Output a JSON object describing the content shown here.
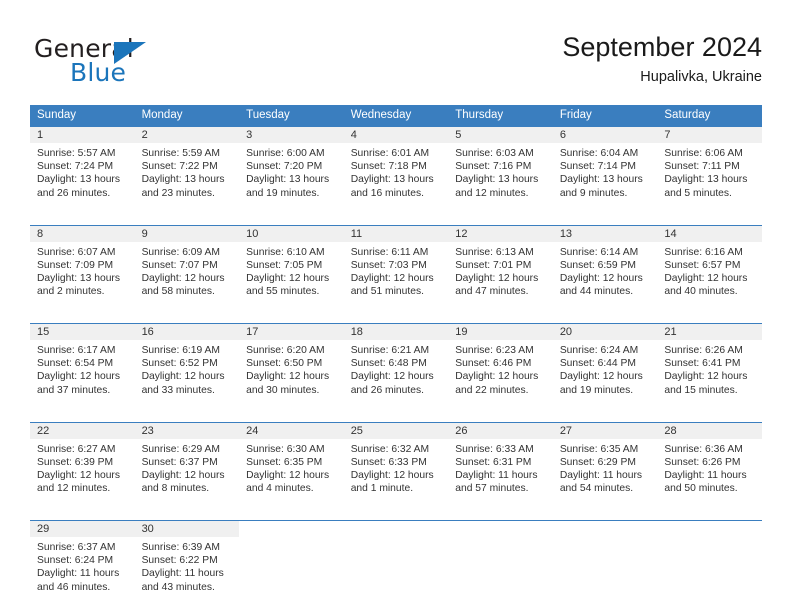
{
  "logo": {
    "word_one": "General",
    "word_two": "Blue",
    "triangle_icon": "blue-triangle-icon"
  },
  "header": {
    "title": "September 2024",
    "location": "Hupalivka, Ukraine"
  },
  "calendar": {
    "accent_color": "#3a7ebf",
    "daynum_band_color": "#f0f0f0",
    "weekday_headers": [
      "Sunday",
      "Monday",
      "Tuesday",
      "Wednesday",
      "Thursday",
      "Friday",
      "Saturday"
    ],
    "weeks": [
      [
        {
          "day": "1",
          "sunrise": "Sunrise: 5:57 AM",
          "sunset": "Sunset: 7:24 PM",
          "daylight_line1": "Daylight: 13 hours",
          "daylight_line2": "and 26 minutes."
        },
        {
          "day": "2",
          "sunrise": "Sunrise: 5:59 AM",
          "sunset": "Sunset: 7:22 PM",
          "daylight_line1": "Daylight: 13 hours",
          "daylight_line2": "and 23 minutes."
        },
        {
          "day": "3",
          "sunrise": "Sunrise: 6:00 AM",
          "sunset": "Sunset: 7:20 PM",
          "daylight_line1": "Daylight: 13 hours",
          "daylight_line2": "and 19 minutes."
        },
        {
          "day": "4",
          "sunrise": "Sunrise: 6:01 AM",
          "sunset": "Sunset: 7:18 PM",
          "daylight_line1": "Daylight: 13 hours",
          "daylight_line2": "and 16 minutes."
        },
        {
          "day": "5",
          "sunrise": "Sunrise: 6:03 AM",
          "sunset": "Sunset: 7:16 PM",
          "daylight_line1": "Daylight: 13 hours",
          "daylight_line2": "and 12 minutes."
        },
        {
          "day": "6",
          "sunrise": "Sunrise: 6:04 AM",
          "sunset": "Sunset: 7:14 PM",
          "daylight_line1": "Daylight: 13 hours",
          "daylight_line2": "and 9 minutes."
        },
        {
          "day": "7",
          "sunrise": "Sunrise: 6:06 AM",
          "sunset": "Sunset: 7:11 PM",
          "daylight_line1": "Daylight: 13 hours",
          "daylight_line2": "and 5 minutes."
        }
      ],
      [
        {
          "day": "8",
          "sunrise": "Sunrise: 6:07 AM",
          "sunset": "Sunset: 7:09 PM",
          "daylight_line1": "Daylight: 13 hours",
          "daylight_line2": "and 2 minutes."
        },
        {
          "day": "9",
          "sunrise": "Sunrise: 6:09 AM",
          "sunset": "Sunset: 7:07 PM",
          "daylight_line1": "Daylight: 12 hours",
          "daylight_line2": "and 58 minutes."
        },
        {
          "day": "10",
          "sunrise": "Sunrise: 6:10 AM",
          "sunset": "Sunset: 7:05 PM",
          "daylight_line1": "Daylight: 12 hours",
          "daylight_line2": "and 55 minutes."
        },
        {
          "day": "11",
          "sunrise": "Sunrise: 6:11 AM",
          "sunset": "Sunset: 7:03 PM",
          "daylight_line1": "Daylight: 12 hours",
          "daylight_line2": "and 51 minutes."
        },
        {
          "day": "12",
          "sunrise": "Sunrise: 6:13 AM",
          "sunset": "Sunset: 7:01 PM",
          "daylight_line1": "Daylight: 12 hours",
          "daylight_line2": "and 47 minutes."
        },
        {
          "day": "13",
          "sunrise": "Sunrise: 6:14 AM",
          "sunset": "Sunset: 6:59 PM",
          "daylight_line1": "Daylight: 12 hours",
          "daylight_line2": "and 44 minutes."
        },
        {
          "day": "14",
          "sunrise": "Sunrise: 6:16 AM",
          "sunset": "Sunset: 6:57 PM",
          "daylight_line1": "Daylight: 12 hours",
          "daylight_line2": "and 40 minutes."
        }
      ],
      [
        {
          "day": "15",
          "sunrise": "Sunrise: 6:17 AM",
          "sunset": "Sunset: 6:54 PM",
          "daylight_line1": "Daylight: 12 hours",
          "daylight_line2": "and 37 minutes."
        },
        {
          "day": "16",
          "sunrise": "Sunrise: 6:19 AM",
          "sunset": "Sunset: 6:52 PM",
          "daylight_line1": "Daylight: 12 hours",
          "daylight_line2": "and 33 minutes."
        },
        {
          "day": "17",
          "sunrise": "Sunrise: 6:20 AM",
          "sunset": "Sunset: 6:50 PM",
          "daylight_line1": "Daylight: 12 hours",
          "daylight_line2": "and 30 minutes."
        },
        {
          "day": "18",
          "sunrise": "Sunrise: 6:21 AM",
          "sunset": "Sunset: 6:48 PM",
          "daylight_line1": "Daylight: 12 hours",
          "daylight_line2": "and 26 minutes."
        },
        {
          "day": "19",
          "sunrise": "Sunrise: 6:23 AM",
          "sunset": "Sunset: 6:46 PM",
          "daylight_line1": "Daylight: 12 hours",
          "daylight_line2": "and 22 minutes."
        },
        {
          "day": "20",
          "sunrise": "Sunrise: 6:24 AM",
          "sunset": "Sunset: 6:44 PM",
          "daylight_line1": "Daylight: 12 hours",
          "daylight_line2": "and 19 minutes."
        },
        {
          "day": "21",
          "sunrise": "Sunrise: 6:26 AM",
          "sunset": "Sunset: 6:41 PM",
          "daylight_line1": "Daylight: 12 hours",
          "daylight_line2": "and 15 minutes."
        }
      ],
      [
        {
          "day": "22",
          "sunrise": "Sunrise: 6:27 AM",
          "sunset": "Sunset: 6:39 PM",
          "daylight_line1": "Daylight: 12 hours",
          "daylight_line2": "and 12 minutes."
        },
        {
          "day": "23",
          "sunrise": "Sunrise: 6:29 AM",
          "sunset": "Sunset: 6:37 PM",
          "daylight_line1": "Daylight: 12 hours",
          "daylight_line2": "and 8 minutes."
        },
        {
          "day": "24",
          "sunrise": "Sunrise: 6:30 AM",
          "sunset": "Sunset: 6:35 PM",
          "daylight_line1": "Daylight: 12 hours",
          "daylight_line2": "and 4 minutes."
        },
        {
          "day": "25",
          "sunrise": "Sunrise: 6:32 AM",
          "sunset": "Sunset: 6:33 PM",
          "daylight_line1": "Daylight: 12 hours",
          "daylight_line2": "and 1 minute."
        },
        {
          "day": "26",
          "sunrise": "Sunrise: 6:33 AM",
          "sunset": "Sunset: 6:31 PM",
          "daylight_line1": "Daylight: 11 hours",
          "daylight_line2": "and 57 minutes."
        },
        {
          "day": "27",
          "sunrise": "Sunrise: 6:35 AM",
          "sunset": "Sunset: 6:29 PM",
          "daylight_line1": "Daylight: 11 hours",
          "daylight_line2": "and 54 minutes."
        },
        {
          "day": "28",
          "sunrise": "Sunrise: 6:36 AM",
          "sunset": "Sunset: 6:26 PM",
          "daylight_line1": "Daylight: 11 hours",
          "daylight_line2": "and 50 minutes."
        }
      ],
      [
        {
          "day": "29",
          "sunrise": "Sunrise: 6:37 AM",
          "sunset": "Sunset: 6:24 PM",
          "daylight_line1": "Daylight: 11 hours",
          "daylight_line2": "and 46 minutes."
        },
        {
          "day": "30",
          "sunrise": "Sunrise: 6:39 AM",
          "sunset": "Sunset: 6:22 PM",
          "daylight_line1": "Daylight: 11 hours",
          "daylight_line2": "and 43 minutes."
        },
        {
          "day": "",
          "sunrise": "",
          "sunset": "",
          "daylight_line1": "",
          "daylight_line2": ""
        },
        {
          "day": "",
          "sunrise": "",
          "sunset": "",
          "daylight_line1": "",
          "daylight_line2": ""
        },
        {
          "day": "",
          "sunrise": "",
          "sunset": "",
          "daylight_line1": "",
          "daylight_line2": ""
        },
        {
          "day": "",
          "sunrise": "",
          "sunset": "",
          "daylight_line1": "",
          "daylight_line2": ""
        },
        {
          "day": "",
          "sunrise": "",
          "sunset": "",
          "daylight_line1": "",
          "daylight_line2": ""
        }
      ]
    ]
  }
}
